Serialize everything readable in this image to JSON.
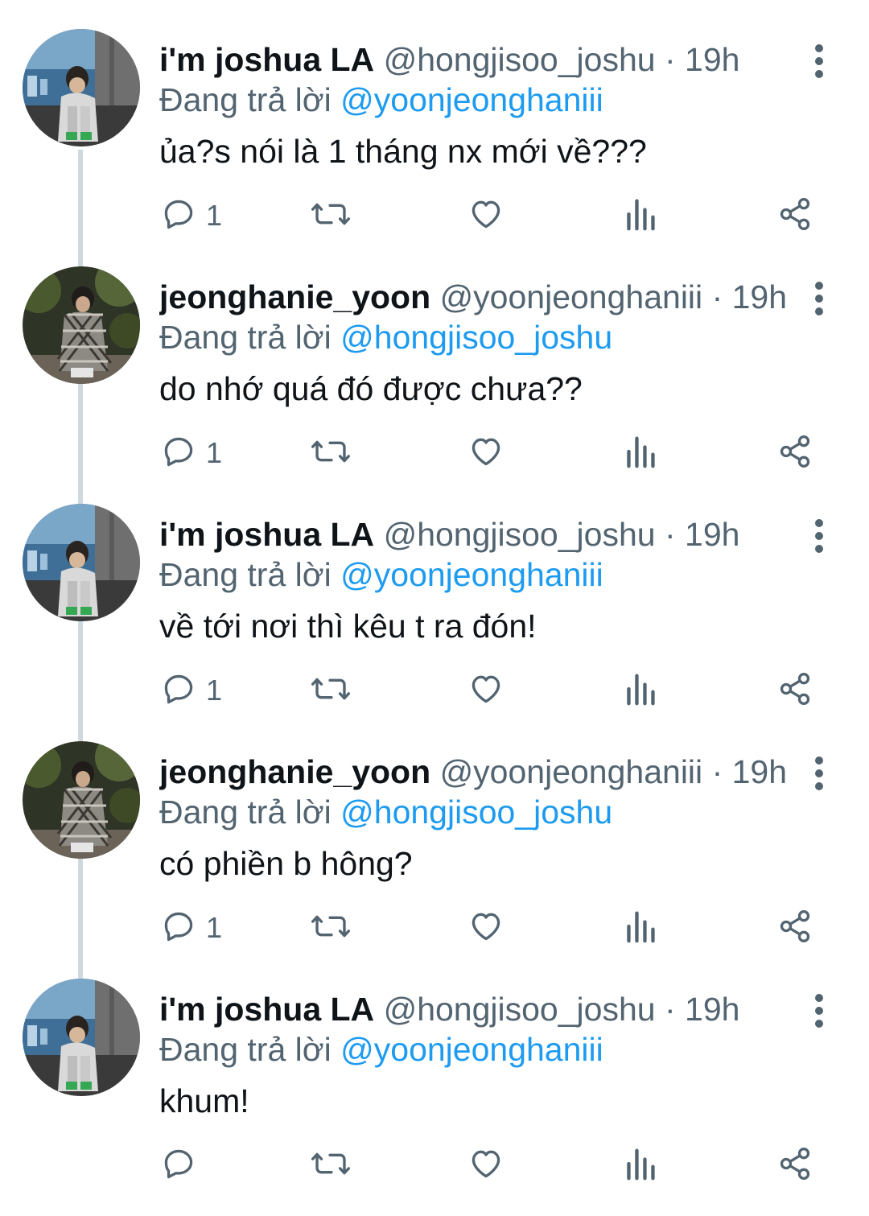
{
  "colors": {
    "thread_line": "#cfd9de",
    "mention": "#1d9bf0",
    "muted": "#536471",
    "text": "#0f1419"
  },
  "tweets": [
    {
      "avatar": "joshua",
      "name": "i'm joshua LA",
      "handle": "@hongjisoo_joshu",
      "dot": "·",
      "time": "19h",
      "reply_prefix": "Đang trả lời",
      "reply_to": "@yoonjeonghaniii",
      "text": "ủa?s nói là 1 tháng nx mới về???",
      "reply_count": "1"
    },
    {
      "avatar": "jeonghan",
      "name": "jeonghanie_yoon",
      "handle": "@yoonjeonghaniii",
      "dot": "·",
      "time": "19h",
      "reply_prefix": "Đang trả lời",
      "reply_to": "@hongjisoo_joshu",
      "text": "do nhớ quá đó được chưa??",
      "reply_count": "1"
    },
    {
      "avatar": "joshua",
      "name": "i'm joshua LA",
      "handle": "@hongjisoo_joshu",
      "dot": "·",
      "time": "19h",
      "reply_prefix": "Đang trả lời",
      "reply_to": "@yoonjeonghaniii",
      "text": "về tới nơi thì kêu t ra đón!",
      "reply_count": "1"
    },
    {
      "avatar": "jeonghan",
      "name": "jeonghanie_yoon",
      "handle": "@yoonjeonghaniii",
      "dot": "·",
      "time": "19h",
      "reply_prefix": "Đang trả lời",
      "reply_to": "@hongjisoo_joshu",
      "text": "có phiền b hông?",
      "reply_count": "1"
    },
    {
      "avatar": "joshua",
      "name": "i'm joshua LA",
      "handle": "@hongjisoo_joshu",
      "dot": "·",
      "time": "19h",
      "reply_prefix": "Đang trả lời",
      "reply_to": "@yoonjeonghaniii",
      "text": "khum!",
      "reply_count": ""
    }
  ],
  "icons": {
    "reply": "reply-icon",
    "retweet": "retweet-icon",
    "like": "heart-icon",
    "views": "views-icon",
    "share": "share-icon",
    "more": "more-vertical-icon"
  }
}
